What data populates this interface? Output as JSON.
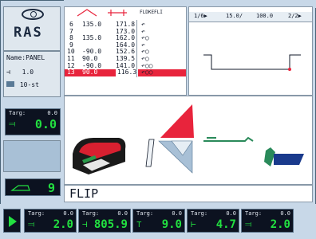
{
  "logo": {
    "text": "RAS"
  },
  "left_panel": {
    "name_label": "Name:PANEL",
    "thickness_value": "1.0",
    "material_label": "10-st"
  },
  "targ_panel": {
    "label": "Targ:",
    "target": "0.0",
    "value": "0.0"
  },
  "tool_panel": {
    "value": "9"
  },
  "top_tabs": [
    "1/6▶",
    "15.0/",
    "100.0",
    "2/2▶"
  ],
  "sequence": {
    "header": "FLDKEFLI",
    "rows": [
      {
        "step": "6",
        "a": "135.0",
        "b": "171.8",
        "sym": "↶"
      },
      {
        "step": "7",
        "a": "",
        "b": "173.0",
        "sym": "↶"
      },
      {
        "step": "8",
        "a": "135.0",
        "b": "162.0",
        "sym": "↶○"
      },
      {
        "step": "9",
        "a": "",
        "b": "164.0",
        "sym": "↶"
      },
      {
        "step": "10",
        "a": "-90.0",
        "b": "152.6",
        "sym": "↶○"
      },
      {
        "step": "11",
        "a": "90.0",
        "b": "139.5",
        "sym": "↶○"
      },
      {
        "step": "12",
        "a": "-90.0",
        "b": "141.0",
        "sym": "↶○○"
      },
      {
        "step": "13",
        "a": "90.0",
        "b": "116.3",
        "sym": "↶○○",
        "selected": true
      }
    ]
  },
  "main_view": {
    "status_text": "FLIP"
  },
  "bottom_bar": [
    {
      "label": "Targ:",
      "target": "0.0",
      "value": "2.0"
    },
    {
      "label": "Targ:",
      "target": "0.0",
      "value": "805.9"
    },
    {
      "label": "Targ:",
      "target": "0.0",
      "value": "9.0"
    },
    {
      "label": "Targ:",
      "target": "0.0",
      "value": "4.7"
    },
    {
      "label": "Targ:",
      "target": "0.0",
      "value": "2.0"
    }
  ],
  "colors": {
    "background": "#c8d8e8",
    "lcd_bg": "#0c1220",
    "lcd_text": "#22e040",
    "accent_red": "#e8243c",
    "part_blue": "#1a3a8c",
    "tool_green": "#2a8a5a"
  },
  "icons": [
    "bend-icon",
    "thickness-icon",
    "material-icon",
    "tool-icon",
    "play-icon",
    "machine-icon"
  ]
}
